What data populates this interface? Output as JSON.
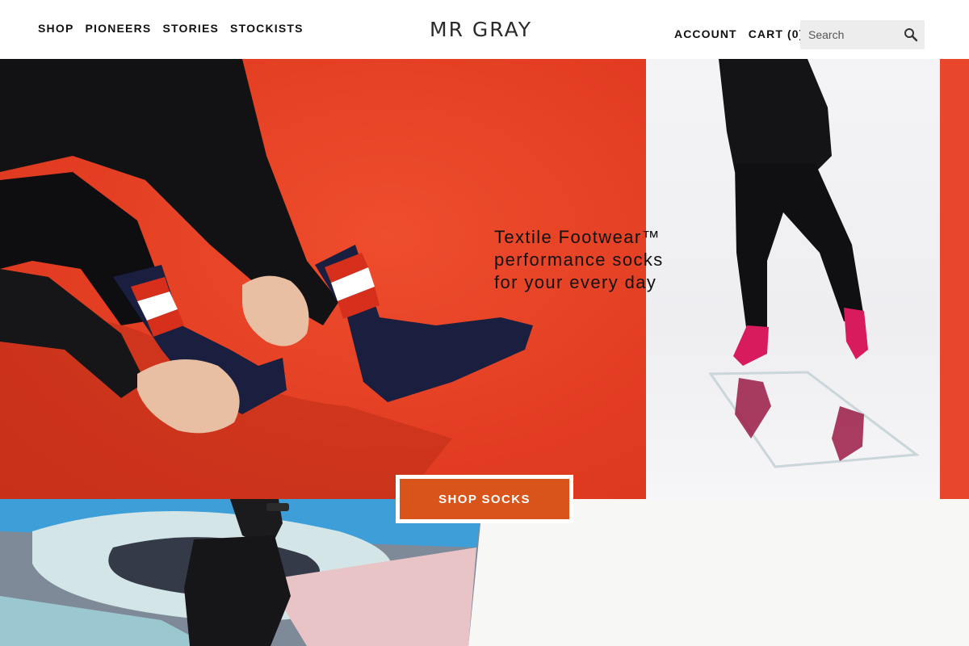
{
  "header": {
    "nav_left": [
      "SHOP",
      "PIONEERS",
      "STORIES",
      "STOCKISTS"
    ],
    "logo": "MR GRAY",
    "account": "ACCOUNT",
    "cart": "CART (0)",
    "search_placeholder": "Search",
    "search_icon": "search-icon"
  },
  "hero": {
    "tagline_lines": [
      "Textile Footwear™",
      "performance socks",
      "for your every day"
    ],
    "cta": "SHOP SOCKS"
  },
  "colors": {
    "accent": "#d9541a",
    "hero_red": "#e8442a",
    "sock_pink": "#d81b5c",
    "sock_navy": "#1a1f3f"
  }
}
